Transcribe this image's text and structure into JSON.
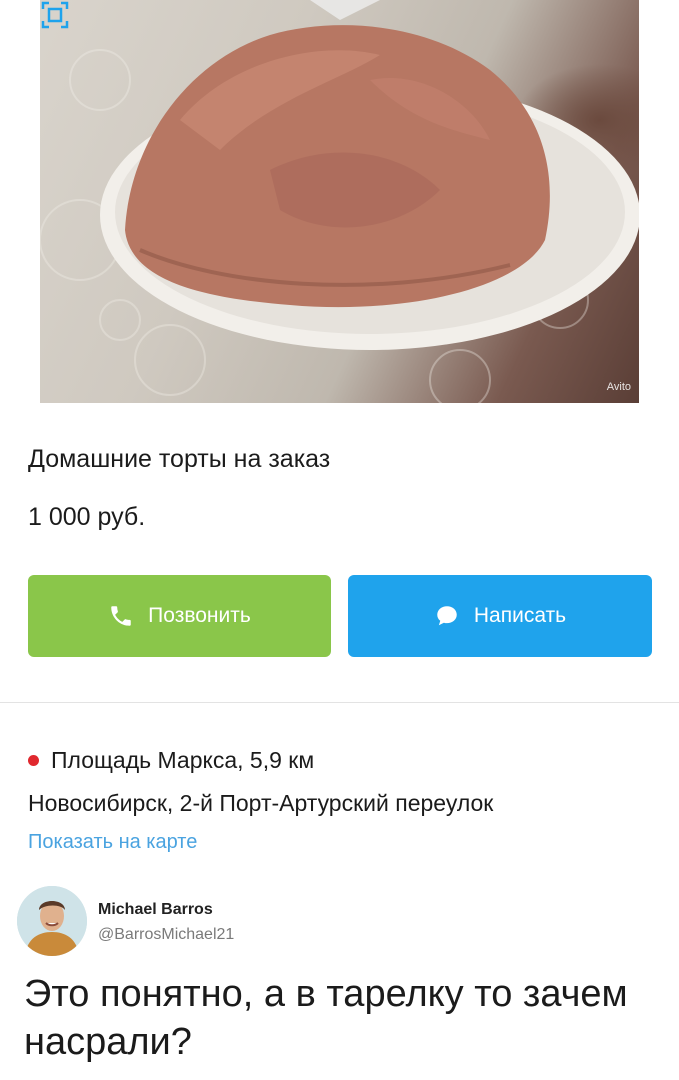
{
  "listing": {
    "title": "Домашние торты на заказ",
    "price": "1 000 руб.",
    "watermark": "Avito",
    "call_label": "Позвонить",
    "write_label": "Написать",
    "metro": "Площадь Маркса, 5,9 км",
    "address": "Новосибирск, 2-й Порт-Артурский переулок",
    "map_link": "Показать на карте"
  },
  "tweet": {
    "author_name": "Michael Barros",
    "author_handle": "@BarrosMichael21",
    "text": "Это понятно, а в тарелку то зачем насрали?"
  },
  "colors": {
    "call_button": "#8ac64a",
    "write_button": "#1fa3ec",
    "metro_dot": "#e0282e",
    "map_link": "#4aa3e0"
  },
  "icons": [
    "expand-icon",
    "phone-icon",
    "chat-bubble-icon"
  ]
}
